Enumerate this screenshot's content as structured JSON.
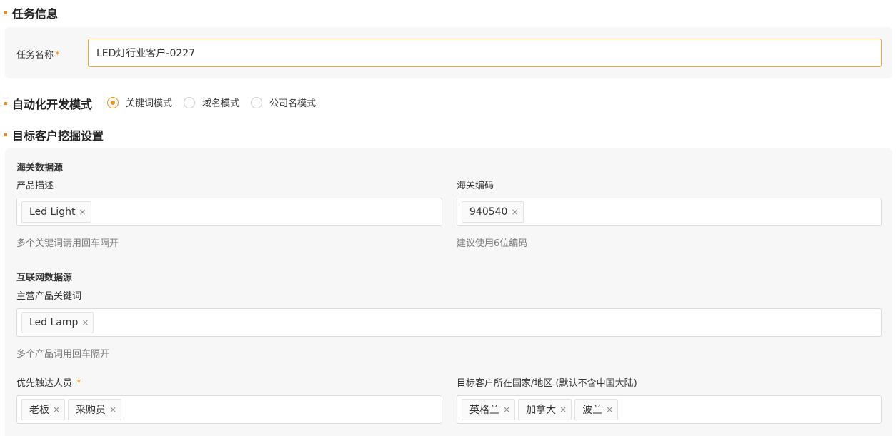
{
  "task_info": {
    "title": "任务信息",
    "name_label": "任务名称",
    "required_mark": "*",
    "name_value": "LED灯行业客户-0227"
  },
  "mode": {
    "title": "自动化开发模式",
    "options": [
      {
        "label": "关键词模式",
        "checked": true
      },
      {
        "label": "域名模式",
        "checked": false
      },
      {
        "label": "公司名模式",
        "checked": false
      }
    ]
  },
  "mining": {
    "title": "目标客户挖掘设置",
    "customs": {
      "title": "海关数据源",
      "product_desc_label": "产品描述",
      "product_desc_tags": [
        "Led Light"
      ],
      "product_desc_hint": "多个关键词请用回车隔开",
      "hs_code_label": "海关编码",
      "hs_code_tags": [
        "940540"
      ],
      "hs_code_hint": "建议使用6位编码"
    },
    "internet": {
      "title": "互联网数据源",
      "keywords_label": "主营产品关键词",
      "keywords_tags": [
        "Led Lamp"
      ],
      "keywords_hint": "多个产品词用回车隔开"
    },
    "contacts_label": "优先触达人员",
    "contacts_required": "*",
    "contacts_tags": [
      "老板",
      "采购员"
    ],
    "regions_label": "目标客户所在国家/地区 (默认不含中国大陆)",
    "regions_tags": [
      "英格兰",
      "加拿大",
      "波兰"
    ]
  },
  "icons": {
    "tag_remove": "×"
  },
  "colors": {
    "accent": "#f08c1e",
    "panel_bg": "#f7f7f7"
  }
}
